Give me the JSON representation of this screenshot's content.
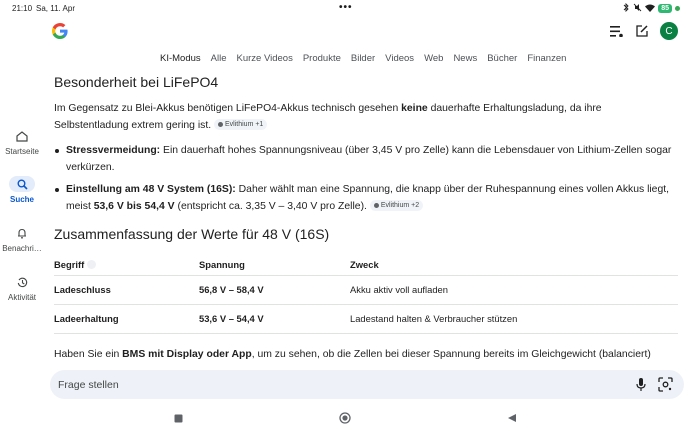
{
  "status": {
    "time": "21:10",
    "date": "Sa, 11. Apr",
    "battery": "85"
  },
  "tabs": [
    "KI-Modus",
    "Alle",
    "Kurze Videos",
    "Produkte",
    "Bilder",
    "Videos",
    "Web",
    "News",
    "Bücher",
    "Finanzen"
  ],
  "header": {
    "avatar_letter": "C"
  },
  "leftnav": {
    "startseite": "Startseite",
    "suche": "Suche",
    "benachrichtigungen": "Benachri…",
    "aktivitaet": "Aktivität"
  },
  "content": {
    "heading1": "Besonderheit bei LiFePO4",
    "para1_a": "Im Gegensatz zu Blei-Akkus benötigen LiFePO4-Akkus technisch gesehen ",
    "para1_bold": "keine",
    "para1_b": " dauerhafte Erhaltungsladung, da ihre Selbstentladung extrem gering ist.",
    "chip1": "Evlithium +1",
    "bullet1_bold": "Stressvermeidung:",
    "bullet1_text": " Ein dauerhaft hohes Spannungsniveau (über 3,45 V pro Zelle) kann die Lebensdauer von Lithium-Zellen sogar verkürzen.",
    "bullet2_bold": "Einstellung am 48 V System (16S):",
    "bullet2_text_a": " Daher wählt man eine Spannung, die knapp über der Ruhespannung eines vollen Akkus liegt, meist ",
    "bullet2_bold2": "53,6 V bis 54,4 V",
    "bullet2_text_b": " (entspricht ca. 3,35 V – 3,40 V pro Zelle).",
    "chip2": "Evlithium +2",
    "heading2": "Zusammenfassung der Werte für 48 V (16S)",
    "closing_a": "Haben Sie ein ",
    "closing_bold": "BMS mit Display oder App",
    "closing_b": ", um zu sehen, ob die Zellen bei dieser Spannung bereits im Gleichgewicht (balanciert)"
  },
  "table": {
    "headers": [
      "Begriff",
      "Spannung",
      "Zweck"
    ],
    "rows": [
      [
        "Ladeschluss",
        "56,8 V – 58,4 V",
        "Akku aktiv voll aufladen"
      ],
      [
        "Ladeerhaltung",
        "53,6 V – 54,4 V",
        "Ladestand halten & Verbraucher stützen"
      ]
    ]
  },
  "askbar": {
    "placeholder": "Frage stellen"
  }
}
